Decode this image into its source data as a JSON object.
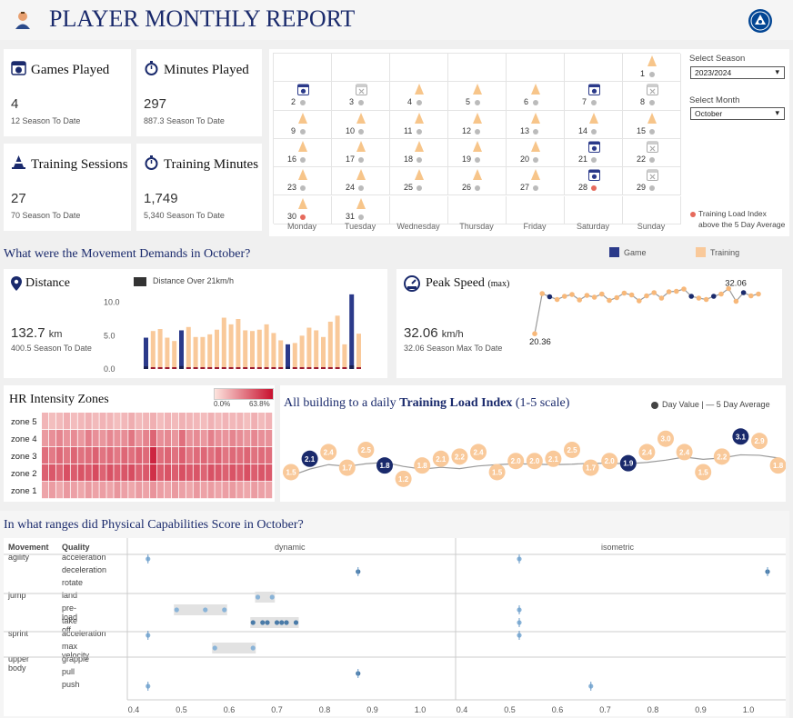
{
  "header": {
    "title": "PLAYER MONTHLY REPORT",
    "user_icon": "user-icon",
    "club_icon": "club-crest-icon"
  },
  "kpis": [
    {
      "title": "Games Played",
      "icon": "soccer-ball-calendar-icon",
      "value": "4",
      "sub": "12 Season To Date"
    },
    {
      "title": "Minutes Played",
      "icon": "stopwatch-icon",
      "value": "297",
      "sub": "887.3 Season To Date"
    },
    {
      "title": "Training Sessions",
      "icon": "cone-icon",
      "value": "27",
      "sub": "70 Season To Date"
    },
    {
      "title": "Training Minutes",
      "icon": "stopwatch-icon",
      "value": "1,749",
      "sub": "5,340 Season To Date"
    }
  ],
  "filters": {
    "season_label": "Select Season",
    "season_value": "2023/2024",
    "month_label": "Select Month",
    "month_value": "October"
  },
  "calendar": {
    "daynames": [
      "Monday",
      "Tuesday",
      "Wednesday",
      "Thursday",
      "Friday",
      "Saturday",
      "Sunday"
    ],
    "days": [
      {
        "n": "1",
        "col": 6,
        "row": 0,
        "type": "training",
        "dot": "grey"
      },
      {
        "n": "2",
        "col": 0,
        "row": 1,
        "type": "game",
        "dot": "grey"
      },
      {
        "n": "3",
        "col": 1,
        "row": 1,
        "type": "off",
        "dot": "grey"
      },
      {
        "n": "4",
        "col": 2,
        "row": 1,
        "type": "training",
        "dot": "grey"
      },
      {
        "n": "5",
        "col": 3,
        "row": 1,
        "type": "training",
        "dot": "grey"
      },
      {
        "n": "6",
        "col": 4,
        "row": 1,
        "type": "training",
        "dot": "grey"
      },
      {
        "n": "7",
        "col": 5,
        "row": 1,
        "type": "game",
        "dot": "grey"
      },
      {
        "n": "8",
        "col": 6,
        "row": 1,
        "type": "off",
        "dot": "grey"
      },
      {
        "n": "9",
        "col": 0,
        "row": 2,
        "type": "training",
        "dot": "grey"
      },
      {
        "n": "10",
        "col": 1,
        "row": 2,
        "type": "training",
        "dot": "grey"
      },
      {
        "n": "11",
        "col": 2,
        "row": 2,
        "type": "training",
        "dot": "grey"
      },
      {
        "n": "12",
        "col": 3,
        "row": 2,
        "type": "training",
        "dot": "grey"
      },
      {
        "n": "13",
        "col": 4,
        "row": 2,
        "type": "training",
        "dot": "grey"
      },
      {
        "n": "14",
        "col": 5,
        "row": 2,
        "type": "training",
        "dot": "grey"
      },
      {
        "n": "15",
        "col": 6,
        "row": 2,
        "type": "training",
        "dot": "grey"
      },
      {
        "n": "16",
        "col": 0,
        "row": 3,
        "type": "training",
        "dot": "grey"
      },
      {
        "n": "17",
        "col": 1,
        "row": 3,
        "type": "training",
        "dot": "grey"
      },
      {
        "n": "18",
        "col": 2,
        "row": 3,
        "type": "training",
        "dot": "grey"
      },
      {
        "n": "19",
        "col": 3,
        "row": 3,
        "type": "training",
        "dot": "grey"
      },
      {
        "n": "20",
        "col": 4,
        "row": 3,
        "type": "training",
        "dot": "grey"
      },
      {
        "n": "21",
        "col": 5,
        "row": 3,
        "type": "game",
        "dot": "grey"
      },
      {
        "n": "22",
        "col": 6,
        "row": 3,
        "type": "off",
        "dot": "grey"
      },
      {
        "n": "23",
        "col": 0,
        "row": 4,
        "type": "training",
        "dot": "grey"
      },
      {
        "n": "24",
        "col": 1,
        "row": 4,
        "type": "training",
        "dot": "grey"
      },
      {
        "n": "25",
        "col": 2,
        "row": 4,
        "type": "training",
        "dot": "grey"
      },
      {
        "n": "26",
        "col": 3,
        "row": 4,
        "type": "training",
        "dot": "grey"
      },
      {
        "n": "27",
        "col": 4,
        "row": 4,
        "type": "training",
        "dot": "grey"
      },
      {
        "n": "28",
        "col": 5,
        "row": 4,
        "type": "game",
        "dot": "red"
      },
      {
        "n": "29",
        "col": 6,
        "row": 4,
        "type": "off",
        "dot": "grey"
      },
      {
        "n": "30",
        "col": 0,
        "row": 5,
        "type": "training",
        "dot": "red"
      },
      {
        "n": "31",
        "col": 1,
        "row": 5,
        "type": "training",
        "dot": "grey"
      }
    ],
    "legend": "Training Load Index above the 5 Day Average"
  },
  "movement": {
    "title": "What were the Movement Demands in October?",
    "legend_game": "Game",
    "legend_training": "Training",
    "colors": {
      "game": "#2b3a8a",
      "training": "#f9c99a",
      "over21": "#2a2a2a"
    }
  },
  "distance": {
    "title": "Distance",
    "icon": "location-pin-icon",
    "value": "132.7",
    "unit": "km",
    "sub": "400.5 Season To Date",
    "legend": "Distance Over 21km/h",
    "yticks": [
      "10.0",
      "5.0",
      "0.0"
    ],
    "chart_data": {
      "type": "bar",
      "ylim": [
        0,
        12
      ],
      "values": [
        4.7,
        5.7,
        6.0,
        4.7,
        4.2,
        5.8,
        6.3,
        4.8,
        4.8,
        5.2,
        5.9,
        7.7,
        6.7,
        7.5,
        5.8,
        5.7,
        5.9,
        6.7,
        5.4,
        4.3,
        3.7,
        3.9,
        5.0,
        6.2,
        5.8,
        4.8,
        7.1,
        8.0,
        3.7,
        11.2,
        5.3
      ],
      "types": [
        "g",
        "t",
        "t",
        "t",
        "t",
        "g",
        "t",
        "t",
        "t",
        "t",
        "t",
        "t",
        "t",
        "t",
        "t",
        "t",
        "t",
        "t",
        "t",
        "t",
        "g",
        "t",
        "t",
        "t",
        "t",
        "t",
        "t",
        "t",
        "t",
        "g",
        "t"
      ],
      "over21": [
        0.35,
        0.1,
        0.1,
        0.1,
        0.1,
        0.4,
        0.1,
        0.1,
        0.1,
        0.1,
        0.1,
        0.1,
        0.1,
        0.1,
        0.1,
        0.1,
        0.1,
        0.1,
        0.1,
        0.1,
        0.3,
        0.1,
        0.1,
        0.1,
        0.1,
        0.1,
        0.1,
        0.1,
        0.1,
        0.5,
        0.1
      ]
    }
  },
  "peak": {
    "title": "Peak Speed",
    "title_suffix": "(max)",
    "icon": "speedometer-icon",
    "value": "32.06",
    "unit": "km/h",
    "sub": "32.06 Season Max To Date",
    "label_min": "20.36",
    "label_max": "32.06",
    "chart_data": {
      "type": "line",
      "ylim": [
        19,
        33
      ],
      "values": [
        20.36,
        29.2,
        28.5,
        27.9,
        28.6,
        29.0,
        27.8,
        28.8,
        28.4,
        29.1,
        27.7,
        28.3,
        29.3,
        28.9,
        27.6,
        28.7,
        29.4,
        28.2,
        29.6,
        29.7,
        30.2,
        28.6,
        28.2,
        27.9,
        28.6,
        29.1,
        30.3,
        27.5,
        29.4,
        28.7,
        29.1
      ],
      "types": [
        "t",
        "t",
        "g",
        "t",
        "t",
        "t",
        "t",
        "t",
        "t",
        "t",
        "t",
        "t",
        "t",
        "t",
        "t",
        "t",
        "t",
        "t",
        "t",
        "t",
        "t",
        "g",
        "t",
        "t",
        "g",
        "t",
        "t",
        "t",
        "g",
        "t",
        "t"
      ]
    }
  },
  "hr": {
    "title": "HR Intensity Zones",
    "legend_min": "0.0%",
    "legend_max": "63.8%",
    "zones": [
      "zone 5",
      "zone 4",
      "zone 3",
      "zone 2",
      "zone 1"
    ],
    "chart_data": {
      "type": "heatmap",
      "rows": [
        "zone 5",
        "zone 4",
        "zone 3",
        "zone 2",
        "zone 1"
      ],
      "values": [
        [
          0.22,
          0.18,
          0.2,
          0.25,
          0.19,
          0.21,
          0.24,
          0.2,
          0.23,
          0.22,
          0.18,
          0.21,
          0.26,
          0.2,
          0.22,
          0.25,
          0.19,
          0.23,
          0.2,
          0.24,
          0.22,
          0.21,
          0.19,
          0.24,
          0.2,
          0.23,
          0.21,
          0.22,
          0.18,
          0.25,
          0.2,
          0.23
        ],
        [
          0.35,
          0.4,
          0.45,
          0.38,
          0.42,
          0.36,
          0.48,
          0.4,
          0.37,
          0.44,
          0.39,
          0.41,
          0.52,
          0.38,
          0.46,
          0.6,
          0.4,
          0.43,
          0.37,
          0.55,
          0.39,
          0.42,
          0.36,
          0.47,
          0.4,
          0.38,
          0.45,
          0.41,
          0.37,
          0.44,
          0.4,
          0.39
        ],
        [
          0.55,
          0.5,
          0.58,
          0.52,
          0.6,
          0.54,
          0.56,
          0.62,
          0.53,
          0.57,
          0.51,
          0.59,
          0.55,
          0.61,
          0.58,
          0.9,
          0.56,
          0.6,
          0.54,
          0.63,
          0.52,
          0.57,
          0.59,
          0.55,
          0.61,
          0.53,
          0.58,
          0.56,
          0.6,
          0.54,
          0.57,
          0.55
        ],
        [
          0.62,
          0.66,
          0.6,
          0.7,
          0.64,
          0.68,
          0.65,
          0.72,
          0.61,
          0.69,
          0.63,
          0.67,
          0.71,
          0.62,
          0.66,
          0.85,
          0.64,
          0.68,
          0.63,
          0.7,
          0.65,
          0.67,
          0.6,
          0.69,
          0.66,
          0.62,
          0.68,
          0.64,
          0.7,
          0.63,
          0.67,
          0.65
        ],
        [
          0.3,
          0.34,
          0.28,
          0.36,
          0.32,
          0.29,
          0.35,
          0.31,
          0.33,
          0.3,
          0.37,
          0.32,
          0.29,
          0.34,
          0.31,
          0.38,
          0.33,
          0.3,
          0.35,
          0.32,
          0.29,
          0.36,
          0.31,
          0.34,
          0.3,
          0.33,
          0.35,
          0.31,
          0.29,
          0.34,
          0.32,
          0.3
        ]
      ]
    }
  },
  "tli": {
    "title_pre": "All building to a daily ",
    "title_bold": "Training Load Index",
    "title_post": " (1-5 scale)",
    "legend": "Day Value | — 5 Day Average",
    "chart_data": {
      "type": "line",
      "ylim": [
        0.5,
        3.6
      ],
      "values": [
        "1.5",
        "2.1",
        "2.4",
        "1.7",
        "2.5",
        "1.8",
        "1.2",
        "1.8",
        "2.1",
        "2.2",
        "2.4",
        "1.5",
        "2.0",
        "2.0",
        "2.1",
        "2.5",
        "1.7",
        "2.0",
        "1.9",
        "2.4",
        "3.0",
        "2.4",
        "1.5",
        "2.2",
        "3.1",
        "2.9",
        "1.8"
      ],
      "types": [
        "t",
        "g",
        "t",
        "t",
        "t",
        "g",
        "t",
        "t",
        "t",
        "t",
        "t",
        "t",
        "t",
        "t",
        "t",
        "t",
        "t",
        "t",
        "g",
        "t",
        "t",
        "t",
        "t",
        "t",
        "g",
        "t",
        "t"
      ]
    }
  },
  "pc": {
    "title": "In what ranges did Physical Capabilities Score in October?",
    "col_movement": "Movement",
    "col_quality": "Quality",
    "panel_dynamic": "dynamic",
    "panel_isometric": "isometric",
    "xticks": [
      "0.4",
      "0.5",
      "0.6",
      "0.7",
      "0.8",
      "0.9",
      "1.0"
    ],
    "groups": [
      {
        "movement": "agility",
        "qualities": [
          "acceleration",
          "deceleration",
          "rotate"
        ]
      },
      {
        "movement": "jump",
        "qualities": [
          "land",
          "pre-load",
          "take off"
        ]
      },
      {
        "movement": "sprint",
        "qualities": [
          "acceleration",
          "max velocity"
        ]
      },
      {
        "movement": "upper body",
        "qualities": [
          "grapple",
          "pull",
          "push"
        ]
      }
    ],
    "chart_data": {
      "type": "scatter",
      "xlim": [
        0.4,
        1.0
      ],
      "rows": [
        {
          "q": "agility acceleration",
          "dyn": [
            0.43
          ],
          "iso": [
            0.52
          ]
        },
        {
          "q": "agility deceleration",
          "dyn": [
            0.87
          ],
          "iso": [
            1.04
          ]
        },
        {
          "q": "agility rotate",
          "dyn": [],
          "iso": []
        },
        {
          "q": "jump land",
          "dyn": [
            0.66,
            0.69
          ],
          "iso": []
        },
        {
          "q": "jump pre-load",
          "dyn": [
            0.49,
            0.55,
            0.59
          ],
          "iso": [
            0.52
          ]
        },
        {
          "q": "jump take off",
          "dyn": [
            0.65,
            0.67,
            0.68,
            0.7,
            0.71,
            0.72,
            0.74
          ],
          "iso": [
            0.52
          ]
        },
        {
          "q": "sprint acceleration",
          "dyn": [
            0.43
          ],
          "iso": [
            0.52
          ]
        },
        {
          "q": "sprint max velocity",
          "dyn": [
            0.57,
            0.65
          ],
          "iso": []
        },
        {
          "q": "upper body grapple",
          "dyn": [],
          "iso": []
        },
        {
          "q": "upper body pull",
          "dyn": [
            0.87
          ],
          "iso": []
        },
        {
          "q": "upper body push",
          "dyn": [
            0.43
          ],
          "iso": [
            0.67
          ]
        }
      ]
    }
  }
}
